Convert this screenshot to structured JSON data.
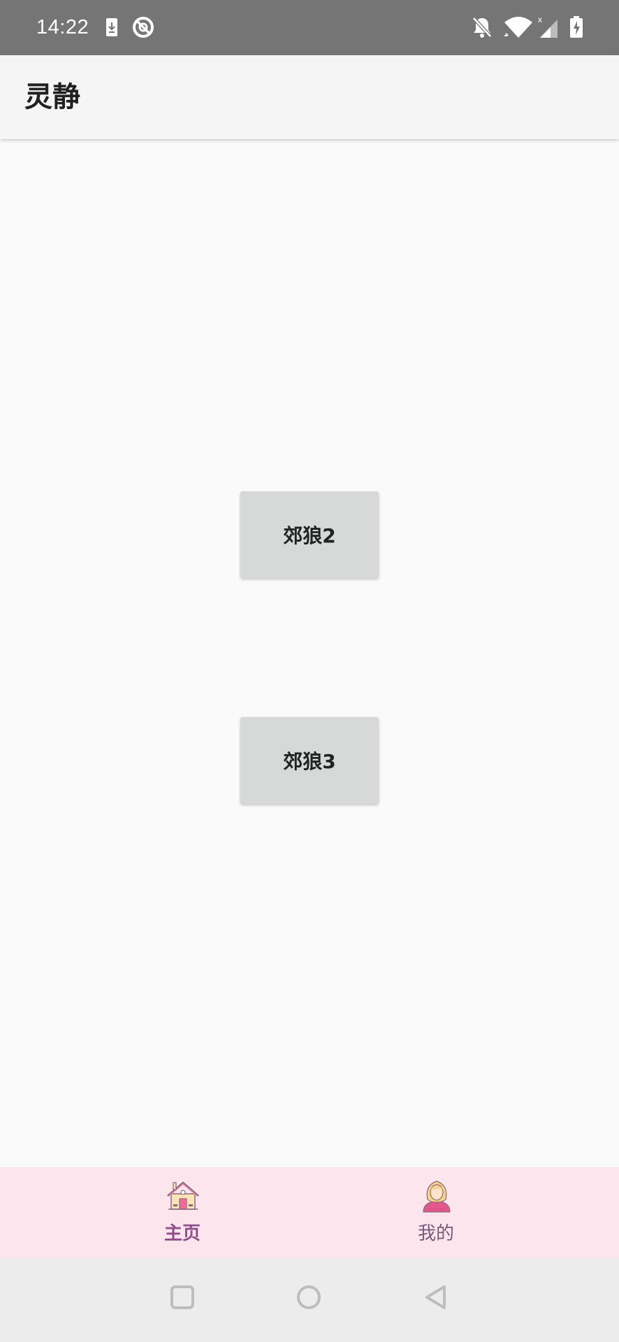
{
  "status_bar": {
    "time": "14:22",
    "icons": [
      "download-icon",
      "vpn-icon",
      "notifications-off-icon",
      "wifi-icon",
      "signal-icon",
      "battery-charging-icon"
    ]
  },
  "app_bar": {
    "title": "灵静"
  },
  "main": {
    "buttons": [
      {
        "label": "郊狼2"
      },
      {
        "label": "郊狼3"
      }
    ]
  },
  "bottom_nav": {
    "items": [
      {
        "label": "主页",
        "icon": "house-icon",
        "selected": true
      },
      {
        "label": "我的",
        "icon": "woman-avatar-icon",
        "selected": false
      }
    ],
    "active_color": "#8e4f8a"
  },
  "system_nav": {
    "buttons": [
      "recents-button",
      "home-button",
      "back-button"
    ]
  },
  "colors": {
    "status_bar": "#757575",
    "app_bar": "#f5f5f5",
    "background": "#fafafa",
    "button": "#d7d8d8",
    "bottom_nav": "#fde5ed",
    "system_nav": "#ececec"
  }
}
